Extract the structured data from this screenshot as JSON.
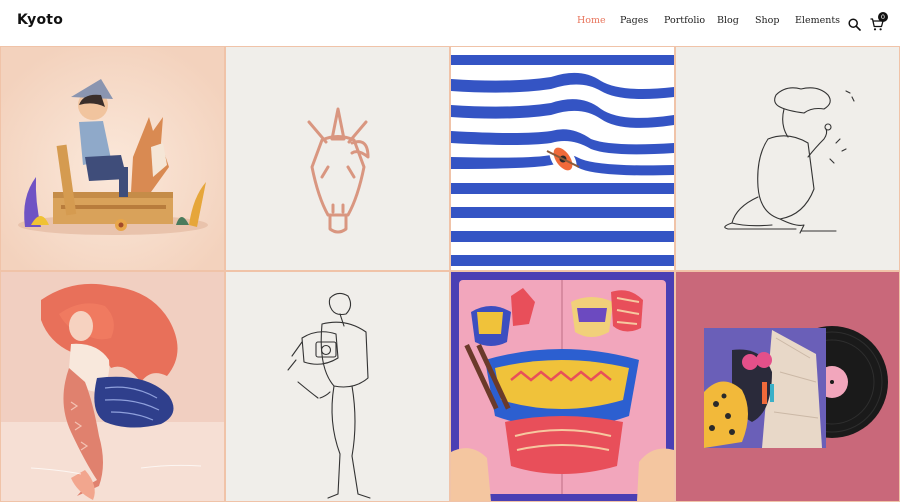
{
  "header": {
    "logo": "Kyoto",
    "nav": [
      {
        "label": "Home",
        "active": true
      },
      {
        "label": "Pages"
      },
      {
        "label": "Portfolio"
      },
      {
        "label": "Blog"
      },
      {
        "label": "Shop"
      },
      {
        "label": "Elements"
      }
    ],
    "search_icon": "search-icon",
    "cart_icon": "cart-icon",
    "cart_count": "0"
  },
  "colors": {
    "accent": "#e8755c",
    "grid_border": "#f0c3a8"
  },
  "portfolio": {
    "items": [
      {
        "name": "boy-with-dog",
        "bg": "#f6dccb"
      },
      {
        "name": "unicorn-line",
        "bg": "#f0eeea"
      },
      {
        "name": "striped-sea-boat",
        "bg": "#ffffff"
      },
      {
        "name": "sitting-figure-line",
        "bg": "#f0eeea"
      },
      {
        "name": "mermaid",
        "bg": "#f1cfc1"
      },
      {
        "name": "figure-with-camera-line",
        "bg": "#f0eeea"
      },
      {
        "name": "popup-book",
        "bg": "#4a3fb4"
      },
      {
        "name": "vinyl-record",
        "bg": "#c9687a"
      }
    ]
  }
}
